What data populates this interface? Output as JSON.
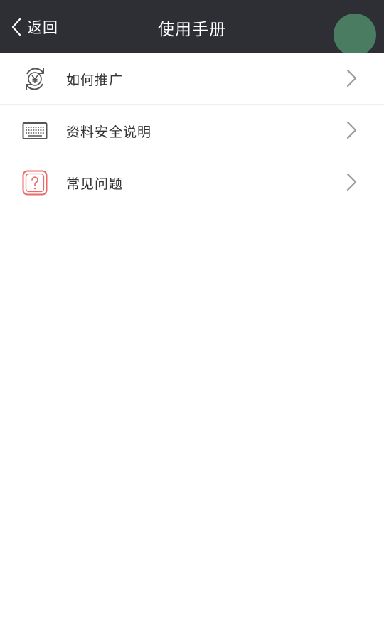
{
  "header": {
    "back_label": "返回",
    "title": "使用手册"
  },
  "list": {
    "items": [
      {
        "label": "如何推广",
        "icon": "yen-refresh-icon"
      },
      {
        "label": "资料安全说明",
        "icon": "keyboard-icon"
      },
      {
        "label": "常见问题",
        "icon": "question-icon"
      }
    ]
  },
  "colors": {
    "header_bg": "#2d2f34",
    "float_button": "#4f8a68",
    "question_icon": "#e86a6a",
    "chevron": "#9a9a9a"
  }
}
